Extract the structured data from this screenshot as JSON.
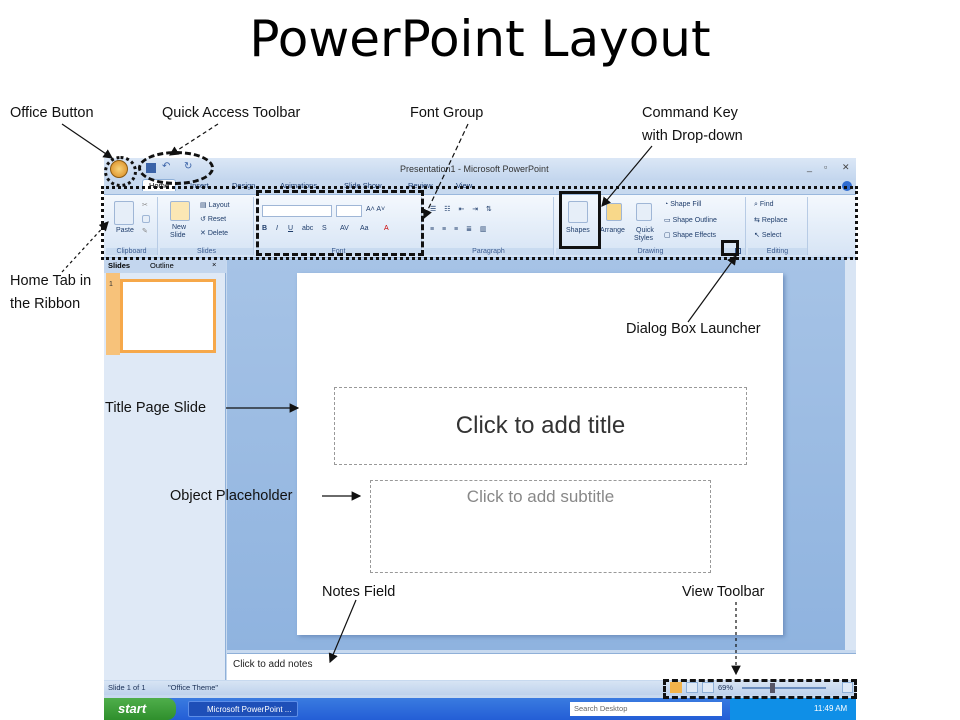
{
  "slide": {
    "title": "PowerPoint Layout"
  },
  "callouts": {
    "office_button": "Office Button",
    "quick_access": "Quick Access Toolbar",
    "font_group": "Font Group",
    "command_key_line1": "Command Key",
    "command_key_line2": "with Drop-down",
    "home_tab_line1": "Home Tab in",
    "home_tab_line2": "the Ribbon",
    "dialog_launcher": "Dialog Box Launcher",
    "title_page_slide": "Title Page Slide",
    "object_placeholder": "Object Placeholder",
    "notes_field": "Notes Field",
    "view_toolbar": "View Toolbar"
  },
  "app": {
    "window_title": "Presentation1 - Microsoft PowerPoint",
    "tabs": [
      "Home",
      "Insert",
      "Design",
      "Animations",
      "Slide Show",
      "Review",
      "View"
    ],
    "ribbon": {
      "clipboard": {
        "name": "Clipboard",
        "paste": "Paste"
      },
      "slides": {
        "name": "Slides",
        "new_slide_1": "New",
        "new_slide_2": "Slide",
        "layout": "Layout",
        "reset": "Reset",
        "delete": "Delete"
      },
      "font": {
        "name": "Font"
      },
      "paragraph": {
        "name": "Paragraph"
      },
      "drawing": {
        "name": "Drawing",
        "shapes": "Shapes",
        "arrange": "Arrange",
        "quick_styles_1": "Quick",
        "quick_styles_2": "Styles",
        "shape_fill": "Shape Fill",
        "shape_outline": "Shape Outline",
        "shape_effects": "Shape Effects"
      },
      "editing": {
        "name": "Editing",
        "find": "Find",
        "replace": "Replace",
        "select": "Select"
      }
    },
    "pane_tabs": [
      "Slides",
      "Outline"
    ],
    "thumb_number": "1",
    "title_placeholder": "Click to add title",
    "subtitle_placeholder": "Click to add subtitle",
    "notes_placeholder": "Click to add notes",
    "status": {
      "slide_count": "Slide 1 of 1",
      "theme": "\"Office Theme\"",
      "zoom": "69%"
    },
    "taskbar": {
      "start": "start",
      "task": "Microsoft PowerPoint ...",
      "search": "Search Desktop",
      "time": "11:49 AM"
    }
  }
}
